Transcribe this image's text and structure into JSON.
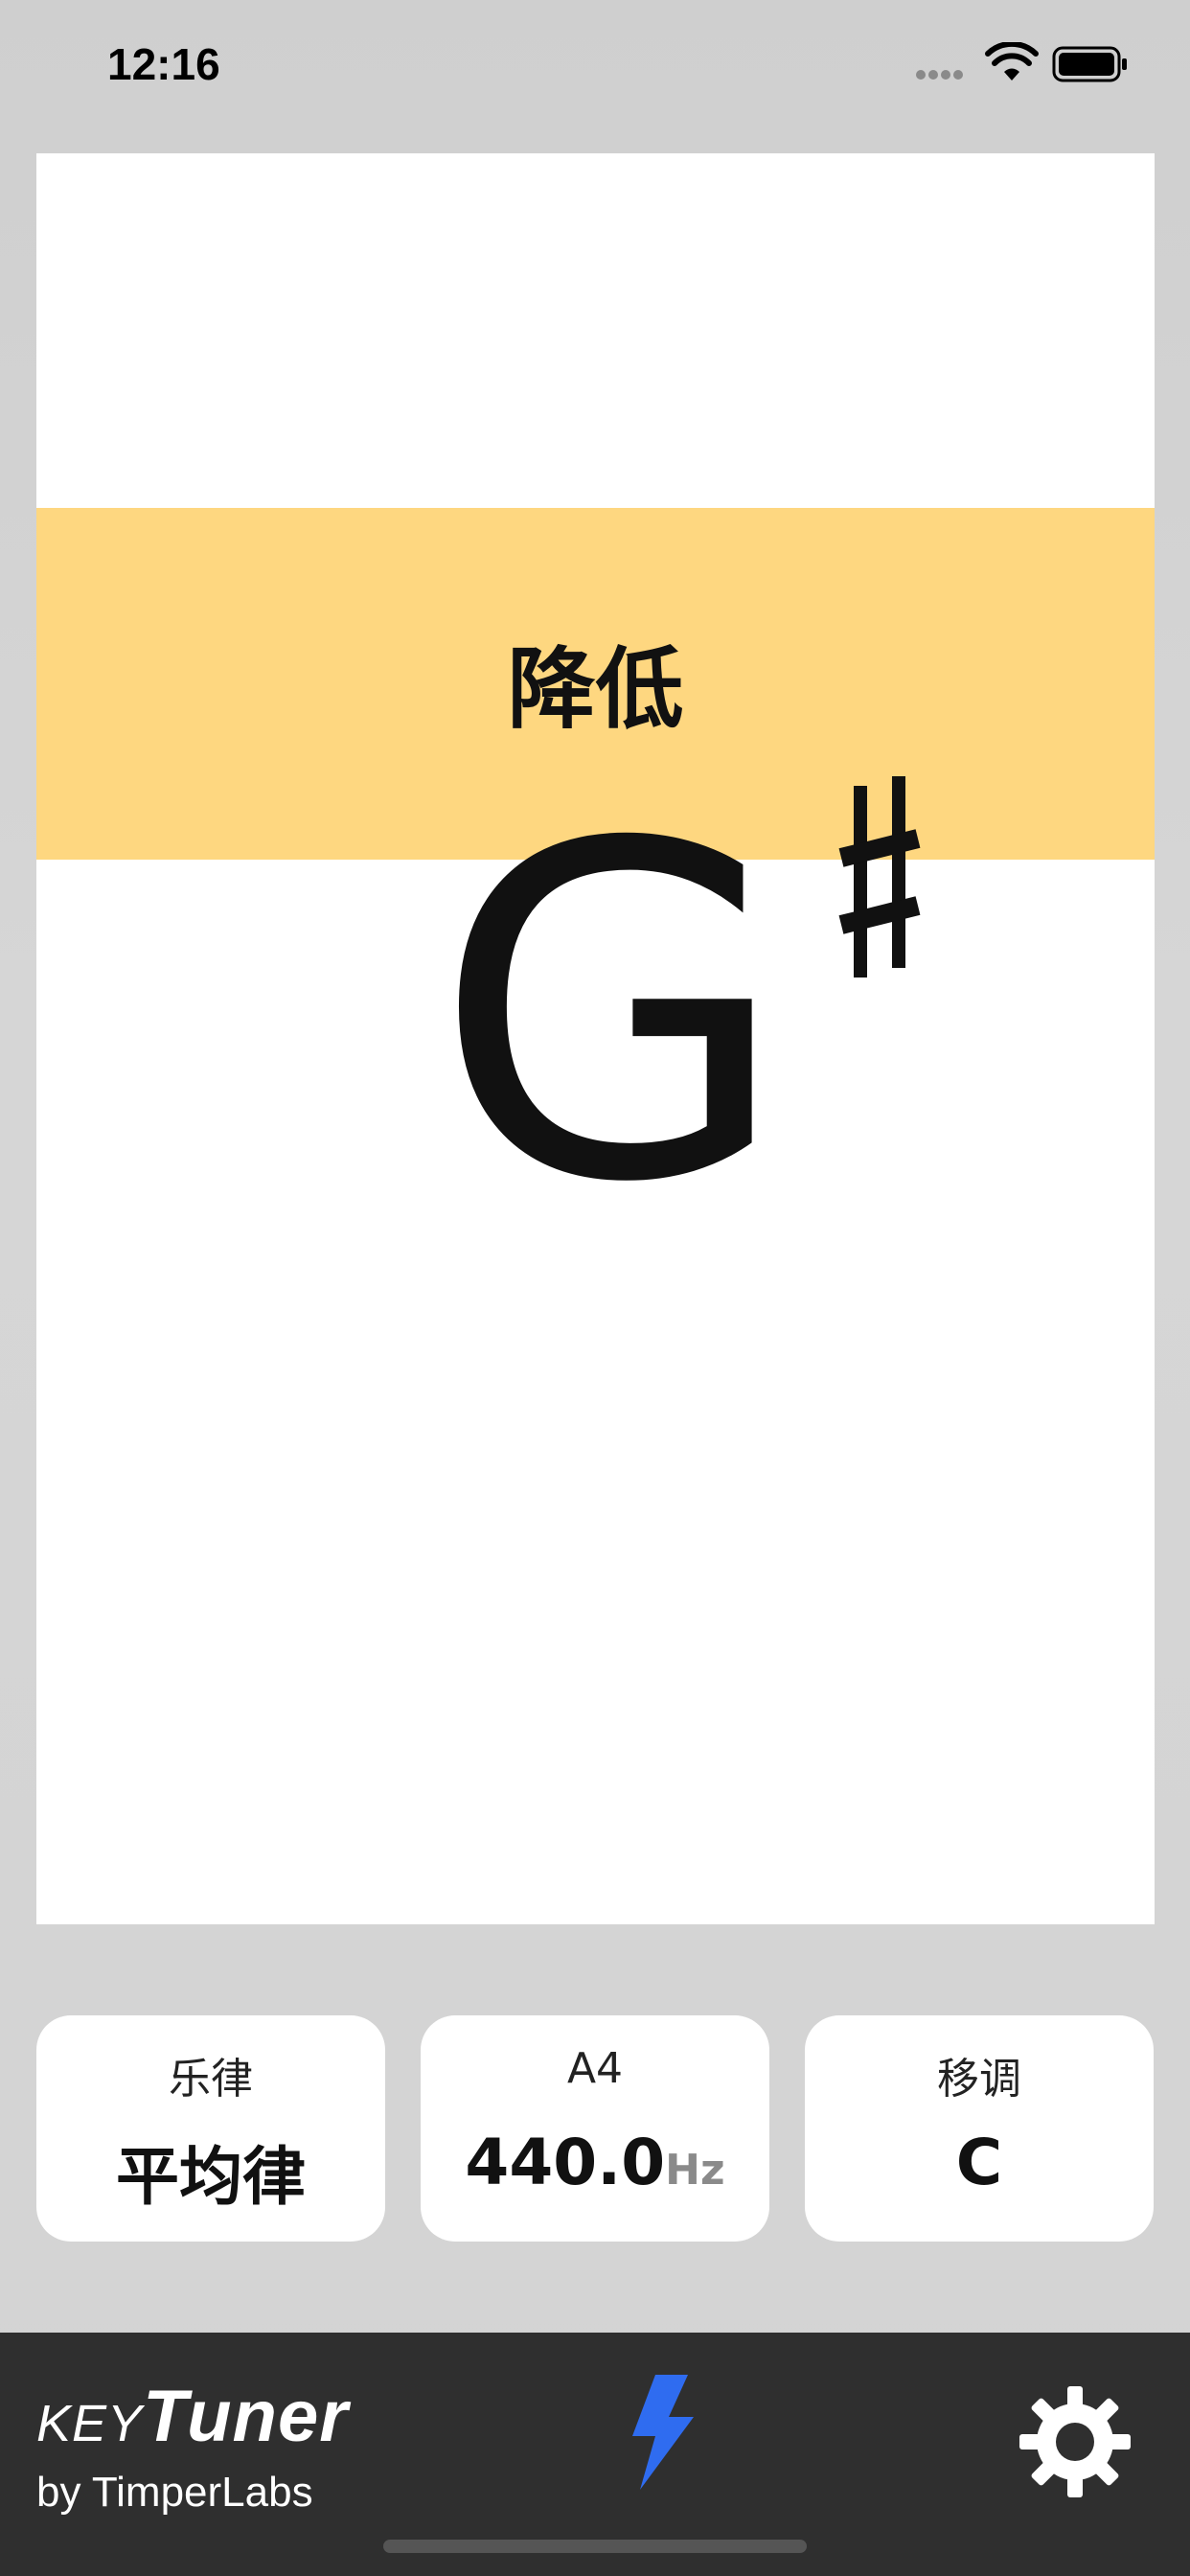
{
  "status": {
    "time": "12:16"
  },
  "tuner": {
    "direction": "降低",
    "note": "G",
    "accidental": "♯"
  },
  "settings": [
    {
      "title": "乐律",
      "value": "平均律",
      "unit": ""
    },
    {
      "title": "A4",
      "value": "440.0",
      "unit": "Hz"
    },
    {
      "title": "移调",
      "value": "C",
      "unit": ""
    }
  ],
  "brand": {
    "key": "KEY",
    "tuner": "Tuner",
    "sub": "by TimperLabs"
  },
  "icons": {
    "bolt": "lightning-bolt-icon",
    "settings": "gear-icon"
  },
  "colors": {
    "band": "#fed780",
    "accent": "#2f6cf0",
    "bar": "#2f2f2f"
  }
}
